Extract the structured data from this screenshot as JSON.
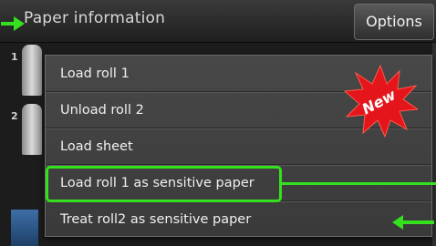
{
  "header": {
    "title": "Paper information",
    "options_label": "Options"
  },
  "background": {
    "row_numbers": [
      "1",
      "2"
    ]
  },
  "menu": {
    "items": [
      {
        "label": "Load roll 1"
      },
      {
        "label": "Unload roll 2"
      },
      {
        "label": "Load sheet"
      },
      {
        "label": "Load roll 1 as sensitive paper"
      },
      {
        "label": "Treat roll2 as sensitive paper"
      }
    ]
  },
  "badge": {
    "text": "New",
    "color": "#e4161b"
  },
  "annotations": {
    "highlight_color": "#35e01e",
    "icons": [
      "arrow-right-icon",
      "arrow-left-icon"
    ]
  }
}
